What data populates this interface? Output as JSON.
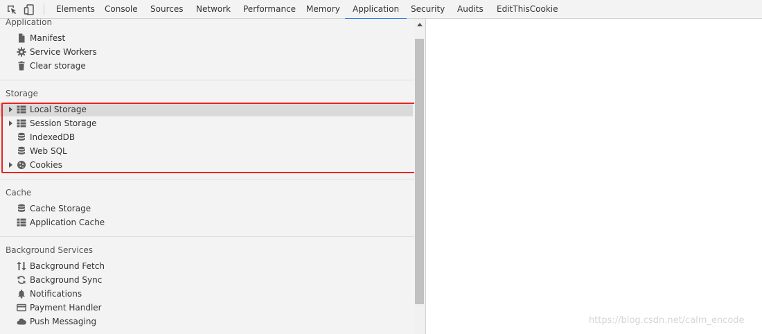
{
  "tabs": [
    {
      "label": "Elements"
    },
    {
      "label": "Console"
    },
    {
      "label": "Sources"
    },
    {
      "label": "Network"
    },
    {
      "label": "Performance"
    },
    {
      "label": "Memory"
    },
    {
      "label": "Application",
      "active": true
    },
    {
      "label": "Security"
    },
    {
      "label": "Audits"
    },
    {
      "label": "EditThisCookie"
    }
  ],
  "toolbar": {
    "inspect_icon": "inspect-element-icon",
    "device_icon": "device-toolbar-icon"
  },
  "sections": {
    "application": {
      "title": "Application",
      "items": [
        {
          "label": "Manifest",
          "icon": "file-icon"
        },
        {
          "label": "Service Workers",
          "icon": "gear-icon"
        },
        {
          "label": "Clear storage",
          "icon": "trash-icon"
        }
      ]
    },
    "storage": {
      "title": "Storage",
      "items": [
        {
          "label": "Local Storage",
          "icon": "grid-icon",
          "expandable": true,
          "selected": true
        },
        {
          "label": "Session Storage",
          "icon": "grid-icon",
          "expandable": true
        },
        {
          "label": "IndexedDB",
          "icon": "database-icon"
        },
        {
          "label": "Web SQL",
          "icon": "database-icon"
        },
        {
          "label": "Cookies",
          "icon": "cookie-icon",
          "expandable": true
        }
      ]
    },
    "cache": {
      "title": "Cache",
      "items": [
        {
          "label": "Cache Storage",
          "icon": "database-icon"
        },
        {
          "label": "Application Cache",
          "icon": "grid-icon"
        }
      ]
    },
    "background": {
      "title": "Background Services",
      "items": [
        {
          "label": "Background Fetch",
          "icon": "up-down-arrows-icon"
        },
        {
          "label": "Background Sync",
          "icon": "sync-icon"
        },
        {
          "label": "Notifications",
          "icon": "bell-icon"
        },
        {
          "label": "Payment Handler",
          "icon": "card-icon"
        },
        {
          "label": "Push Messaging",
          "icon": "cloud-icon"
        }
      ]
    }
  },
  "watermark": "https://blog.csdn.net/calm_encode",
  "colors": {
    "highlight": "#e8231f",
    "active_tab_underline": "#1a73e8",
    "sidebar_bg": "#f3f3f3"
  }
}
